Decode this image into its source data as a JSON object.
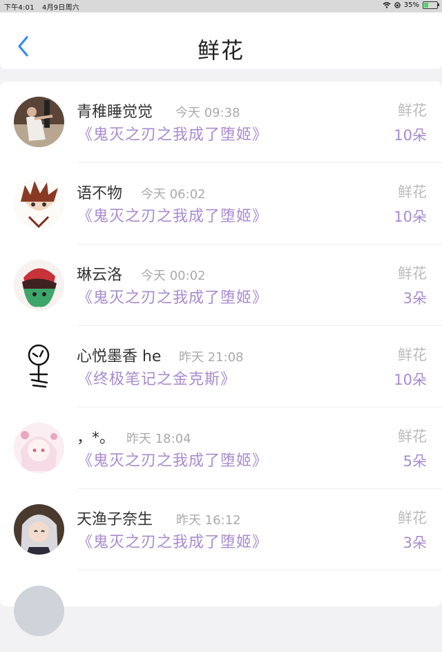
{
  "status_bar": {
    "time": "下午4:01",
    "date": "4月9日周六",
    "battery": "35%",
    "battery_level": 0.35
  },
  "header": {
    "title": "鲜花"
  },
  "records": [
    {
      "user": "青稚睡觉觉",
      "time": "今天 09:38",
      "book": "《鬼灭之刃之我成了堕姬》",
      "gift_type": "鲜花",
      "count": "10朵"
    },
    {
      "user": "语不物",
      "time": "今天 06:02",
      "book": "《鬼灭之刃之我成了堕姬》",
      "gift_type": "鲜花",
      "count": "10朵"
    },
    {
      "user": "琳云洛",
      "time": "今天 00:02",
      "book": "《鬼灭之刃之我成了堕姬》",
      "gift_type": "鲜花",
      "count": "3朵"
    },
    {
      "user": "心悦墨香 he",
      "time": "昨天 21:08",
      "book": "《终极笔记之金克斯》",
      "gift_type": "鲜花",
      "count": "10朵"
    },
    {
      "user": "，*。",
      "time": "昨天 18:04",
      "book": "《鬼灭之刃之我成了堕姬》",
      "gift_type": "鲜花",
      "count": "5朵"
    },
    {
      "user": "天渔子奈生",
      "time": "昨天 16:12",
      "book": "《鬼灭之刃之我成了堕姬》",
      "gift_type": "鲜花",
      "count": "3朵"
    }
  ]
}
